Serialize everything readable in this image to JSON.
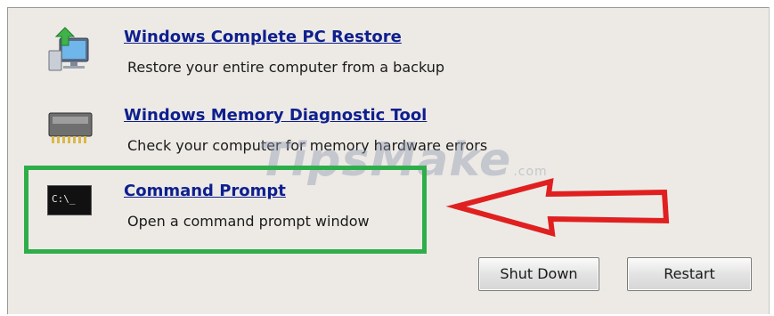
{
  "options": [
    {
      "title": "Windows Complete PC Restore",
      "description": "Restore your entire computer from a backup",
      "icon": "pc-restore-icon"
    },
    {
      "title": "Windows Memory Diagnostic Tool",
      "description": "Check your computer for memory hardware errors",
      "icon": "memory-chip-icon"
    },
    {
      "title": "Command Prompt",
      "description": "Open a command prompt window",
      "icon": "command-prompt-icon",
      "icon_text": "C:\\_"
    }
  ],
  "buttons": {
    "shutdown": "Shut Down",
    "restart": "Restart"
  },
  "watermark": {
    "text": "TipsMake",
    "suffix": ".com"
  },
  "annotations": {
    "highlight_color": "#2eae4a",
    "arrow_color": "#e02020"
  },
  "colors": {
    "link": "#0e1f8e",
    "panel": "#edeae5"
  }
}
